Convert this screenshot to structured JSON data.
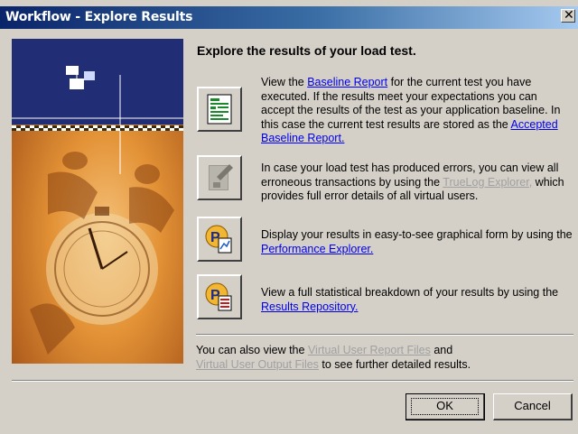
{
  "window": {
    "title": "Workflow - Explore Results",
    "close_glyph": "✕",
    "close_icon": "close-icon"
  },
  "heading": "Explore the results of your load test.",
  "rows": [
    {
      "icon": "baseline-report-icon",
      "pre": "View the ",
      "link1": "Baseline Report",
      "mid": " for the current test you have executed. If the results meet your expectations you can accept the results of the test as your application baseline. In this case the current test results are stored as the ",
      "link2": "Accepted Baseline Report.",
      "post": ""
    },
    {
      "icon": "truelog-explorer-icon",
      "disabled": true,
      "pre": "In case your load test has produced errors, you can view all erroneous transactions by using the ",
      "link1": "TrueLog Explorer,",
      "mid": " which provides full error details of all virtual users."
    },
    {
      "icon": "performance-explorer-icon",
      "pre": "Display your results in easy-to-see graphical form by using the ",
      "link1": "Performance Explorer."
    },
    {
      "icon": "results-repository-icon",
      "pre": "View a full statistical breakdown of your results by using the ",
      "link1": "Results Repository."
    }
  ],
  "footer": {
    "pre": "You can also view the ",
    "link1": "Virtual User Report Files",
    "mid": " and",
    "link2": "Virtual User Output Files",
    "post": " to see further detailed results."
  },
  "buttons": {
    "ok": "OK",
    "cancel": "Cancel"
  },
  "colors": {
    "banner_sky": "#1f2a6e",
    "banner_orange": "#e08a2a",
    "link": "#0000ee",
    "disabled": "#a0a0a0"
  }
}
